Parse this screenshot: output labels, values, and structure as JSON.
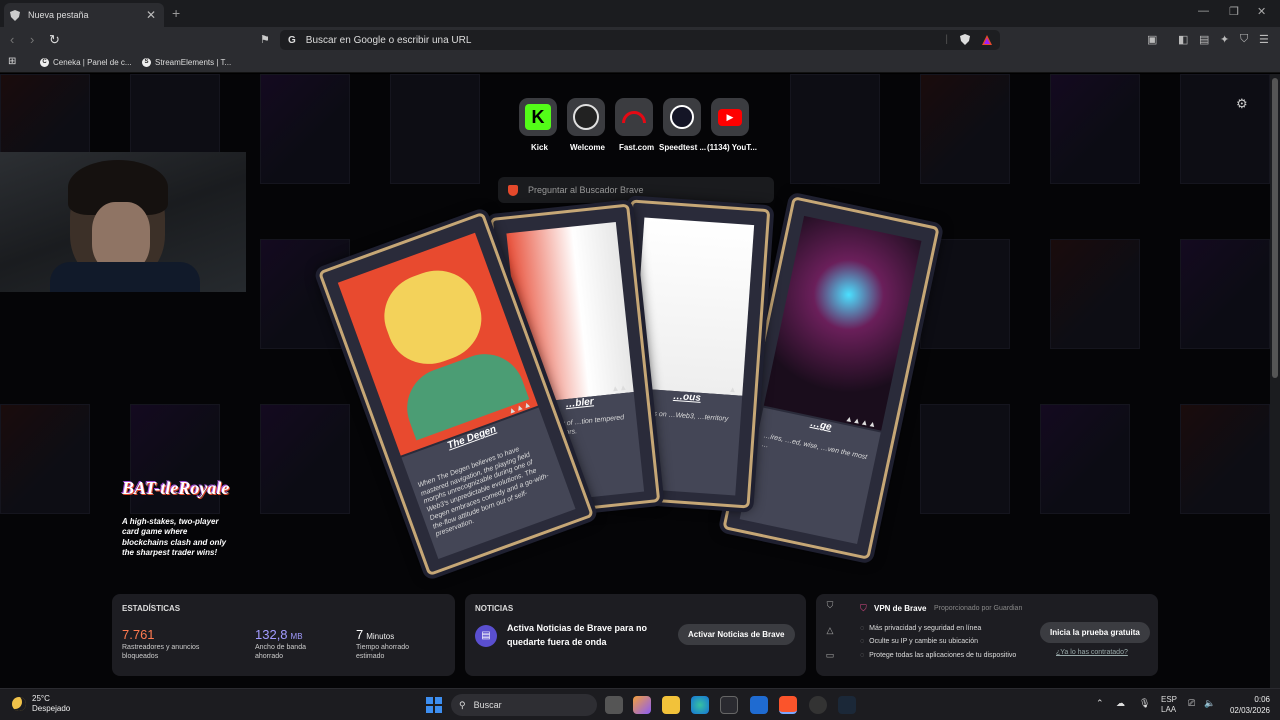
{
  "browser": {
    "tab_title": "Nueva pestaña",
    "new_tab": "+",
    "close": "✕",
    "omnibox_placeholder": "Buscar en Google o escribir una URL",
    "bookmarks": [
      "Ceneka | Panel de c...",
      "StreamElements | T..."
    ]
  },
  "top_sites": [
    {
      "label": "Kick",
      "icon": "kick-icon",
      "color": "#53fc18"
    },
    {
      "label": "Welcome",
      "icon": "obs-icon",
      "color": "#e0e0e0"
    },
    {
      "label": "Fast.com",
      "icon": "fast-icon",
      "color": "#e50914"
    },
    {
      "label": "Speedtest ...",
      "icon": "speedtest-icon",
      "color": "#ffffff"
    },
    {
      "label": "(1134) YouT...",
      "icon": "youtube-icon",
      "color": "#ff0000"
    }
  ],
  "search": {
    "placeholder": "Preguntar al Buscador Brave"
  },
  "promo": {
    "logo": "BAT-tleRoyale",
    "text": "A high-stakes, two-player card game where blockchains clash and only the sharpest trader wins!"
  },
  "cards": [
    {
      "name": "The Degen",
      "text": "When The Degen believes to have mastered navigation, the playing field morphs unrecognizable during one of Web3's unpredictable evolutions. The Degen embraces comedy and a go-with-the-flow attitude born out of self-preservation."
    },
    {
      "name": "…bler",
      "text": "…difficulty of …tion tempered by …ly errors."
    },
    {
      "name": "…ous",
      "text": "…urks on …Web3, …territory …ist."
    },
    {
      "name": "…ge",
      "text": "…ires, …ed, wise, …ven the most …"
    }
  ],
  "stats": {
    "title": "ESTADÍSTICAS",
    "items": [
      {
        "value": "7.761",
        "unit": "",
        "label": "Rastreadores y anuncios bloqueados",
        "color": "#ff7a50"
      },
      {
        "value": "132,8",
        "unit": "MB",
        "label": "Ancho de banda ahorrado",
        "color": "#a29bff"
      },
      {
        "value": "7",
        "unit": "Minutos",
        "label": "Tiempo ahorrado estimado",
        "color": "#ffffff"
      }
    ]
  },
  "news": {
    "title": "NOTICIAS",
    "text": "Activa Noticias de Brave para no quedarte fuera de onda",
    "button": "Activar Noticias de Brave"
  },
  "vpn": {
    "title": "VPN de Brave",
    "provider": "Proporcionado por  Guardian",
    "features": [
      "Más privacidad y seguridad en línea",
      "Oculte su IP y cambie su ubicación",
      "Protege todas las aplicaciones de tu dispositivo"
    ],
    "button": "Inicia la prueba gratuita",
    "link": "¿Ya lo has contratado?"
  },
  "taskbar": {
    "temp": "25°C",
    "weather": "Despejado",
    "search": "Buscar",
    "lang1": "ESP",
    "lang2": "LAA",
    "time": "0:06",
    "date": "02/03/2026"
  }
}
